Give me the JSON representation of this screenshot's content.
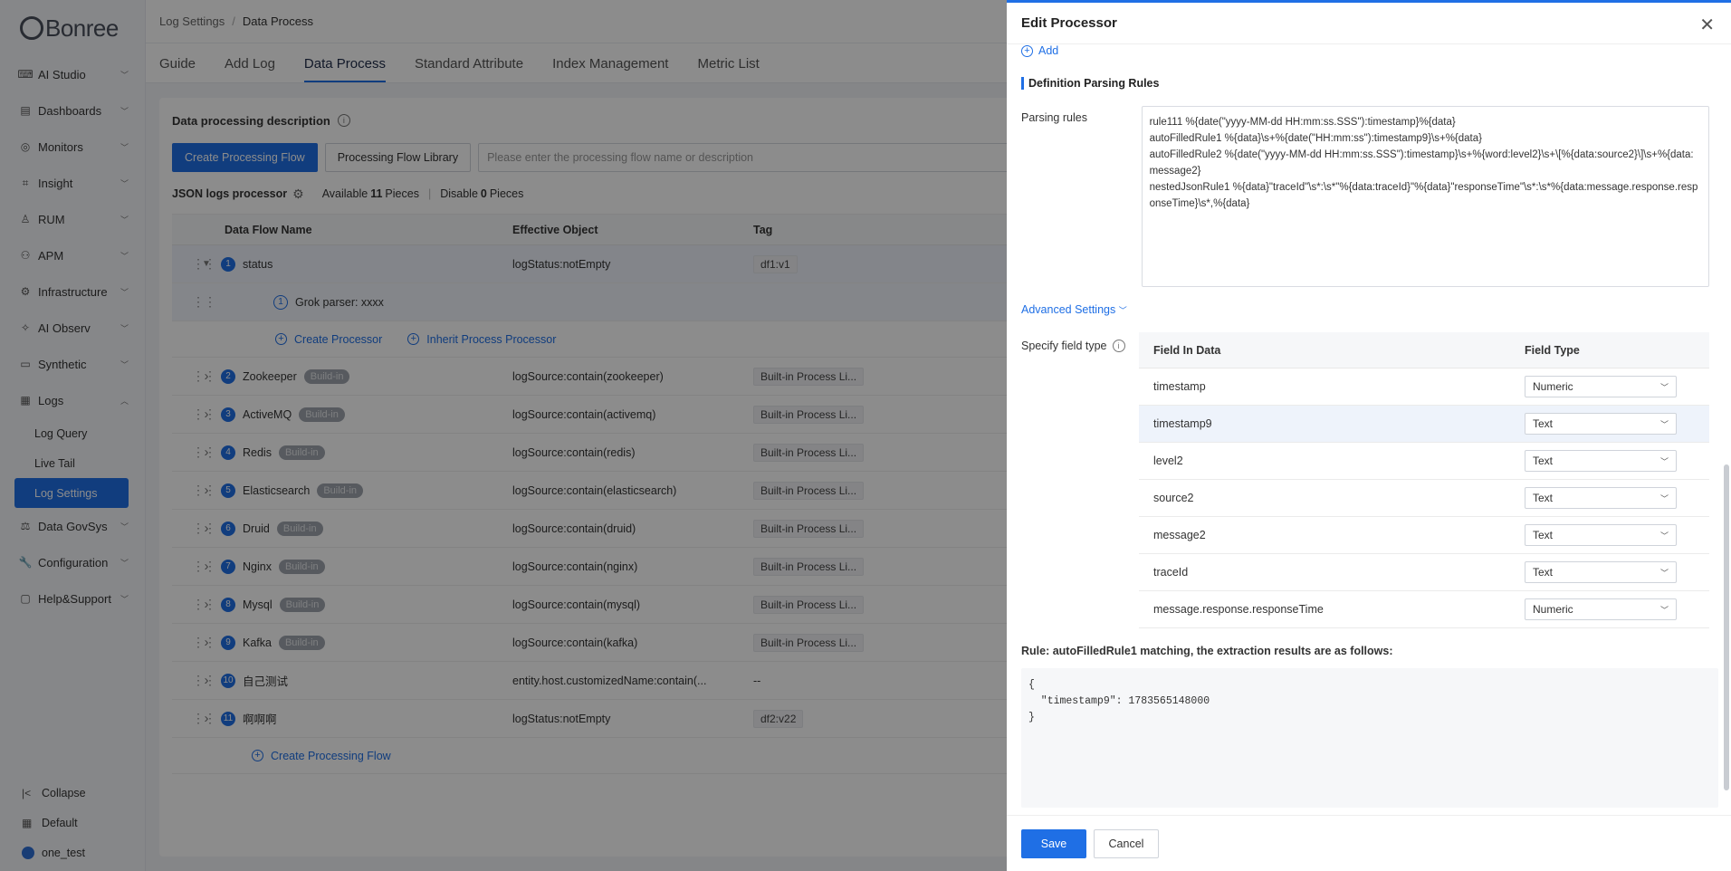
{
  "brand": "Bonree",
  "sidebar": {
    "items": [
      {
        "label": "AI Studio",
        "icon": "ai-studio-icon",
        "glyph": "⌨"
      },
      {
        "label": "Dashboards",
        "icon": "dashboard-icon",
        "glyph": "▤"
      },
      {
        "label": "Monitors",
        "icon": "monitor-icon",
        "glyph": "◎"
      },
      {
        "label": "Insight",
        "icon": "insight-icon",
        "glyph": "⌗"
      },
      {
        "label": "RUM",
        "icon": "rum-icon",
        "glyph": "♙"
      },
      {
        "label": "APM",
        "icon": "apm-icon",
        "glyph": "⚇"
      },
      {
        "label": "Infrastructure",
        "icon": "infrastructure-icon",
        "glyph": "⚙"
      },
      {
        "label": "AI Observ",
        "icon": "ai-observ-icon",
        "glyph": "✧"
      },
      {
        "label": "Synthetic",
        "icon": "synthetic-icon",
        "glyph": "▭"
      },
      {
        "label": "Logs",
        "icon": "logs-icon",
        "glyph": "▦"
      }
    ],
    "logs_sub": [
      "Log Query",
      "Live Tail",
      "Log Settings"
    ],
    "items_after": [
      {
        "label": "Data GovSys",
        "icon": "data-govsys-icon",
        "glyph": "⚖"
      },
      {
        "label": "Configuration",
        "icon": "configuration-icon",
        "glyph": "🔧"
      },
      {
        "label": "Help&Support",
        "icon": "help-icon",
        "glyph": "▢"
      }
    ],
    "collapse": "Collapse",
    "default": "Default",
    "user": "one_test"
  },
  "breadcrumb": {
    "parent": "Log Settings",
    "current": "Data Process"
  },
  "tabs": [
    "Guide",
    "Add Log",
    "Data Process",
    "Standard Attribute",
    "Index Management",
    "Metric List"
  ],
  "main": {
    "desc_title": "Data processing description",
    "create_btn": "Create Processing Flow",
    "library_btn": "Processing Flow Library",
    "search_placeholder": "Please enter the processing flow name or description",
    "json_title": "JSON logs processor",
    "available_label": "Available",
    "available_count": "11",
    "pieces1": "Pieces",
    "disable_label": "Disable",
    "disable_count": "0",
    "pieces2": "Pieces",
    "columns": [
      "Data Flow Name",
      "Effective Object",
      "Tag"
    ],
    "first_row": {
      "num": "1",
      "name": "status",
      "obj": "logStatus:notEmpty",
      "tag": "df1:v1"
    },
    "child_row": {
      "num": "1",
      "name": "Grok parser:  xxxx"
    },
    "create_processor": "Create Processor",
    "inherit_processor": "Inherit Process Processor",
    "rows": [
      {
        "num": "2",
        "name": "Zookeeper",
        "badge": "Build-in",
        "obj": "logSource:contain(zookeeper)",
        "tag": "Built-in Process Li..."
      },
      {
        "num": "3",
        "name": "ActiveMQ",
        "badge": "Build-in",
        "obj": "logSource:contain(activemq)",
        "tag": "Built-in Process Li..."
      },
      {
        "num": "4",
        "name": "Redis",
        "badge": "Build-in",
        "obj": "logSource:contain(redis)",
        "tag": "Built-in Process Li..."
      },
      {
        "num": "5",
        "name": "Elasticsearch",
        "badge": "Build-in",
        "obj": "logSource:contain(elasticsearch)",
        "tag": "Built-in Process Li..."
      },
      {
        "num": "6",
        "name": "Druid",
        "badge": "Build-in",
        "obj": "logSource:contain(druid)",
        "tag": "Built-in Process Li..."
      },
      {
        "num": "7",
        "name": "Nginx",
        "badge": "Build-in",
        "obj": "logSource:contain(nginx)",
        "tag": "Built-in Process Li..."
      },
      {
        "num": "8",
        "name": "Mysql",
        "badge": "Build-in",
        "obj": "logSource:contain(mysql)",
        "tag": "Built-in Process Li..."
      },
      {
        "num": "9",
        "name": "Kafka",
        "badge": "Build-in",
        "obj": "logSource:contain(kafka)",
        "tag": "Built-in Process Li..."
      },
      {
        "num": "10",
        "name": "自己测试",
        "badge": "",
        "obj": "entity.host.customizedName:contain(...",
        "tag": "--"
      },
      {
        "num": "11",
        "name": "啊啊啊",
        "badge": "",
        "obj": "logStatus:notEmpty",
        "tag": "df2:v22"
      }
    ],
    "create_flow_link": "Create Processing Flow"
  },
  "drawer": {
    "title": "Edit Processor",
    "add_label": "Add",
    "section_title": "Definition Parsing Rules",
    "parsing_label": "Parsing rules",
    "parsing_rules": "rule111 %{date(\"yyyy-MM-dd HH:mm:ss.SSS\"):timestamp}%{data}\nautoFilledRule1 %{data}\\s+%{date(\"HH:mm:ss\"):timestamp9}\\s+%{data}\nautoFilledRule2 %{date(\"yyyy-MM-dd HH:mm:ss.SSS\"):timestamp}\\s+%{word:level2}\\s+\\[%{data:source2}\\]\\s+%{data:message2}\nnestedJsonRule1 %{data}\"traceId\"\\s*:\\s*\"%{data:traceId}\"%{data}\"responseTime\"\\s*:\\s*%{data:message.response.responseTime}\\s*,%{data}",
    "advanced": "Advanced Settings",
    "field_type_label": "Specify field type",
    "field_columns": [
      "Field In Data",
      "Field Type"
    ],
    "fields": [
      {
        "name": "timestamp",
        "type": "Numeric"
      },
      {
        "name": "timestamp9",
        "type": "Text"
      },
      {
        "name": "level2",
        "type": "Text"
      },
      {
        "name": "source2",
        "type": "Text"
      },
      {
        "name": "message2",
        "type": "Text"
      },
      {
        "name": "traceId",
        "type": "Text"
      },
      {
        "name": "message.response.responseTime",
        "type": "Numeric"
      }
    ],
    "rule_result_title": "Rule: autoFilledRule1 matching, the extraction results are as follows:",
    "result": "{\n  \"timestamp9\": 1783565148000\n}",
    "save": "Save",
    "cancel": "Cancel"
  },
  "colors": {
    "accent": "#1f6fe5",
    "badge": "#9ea4ad"
  }
}
